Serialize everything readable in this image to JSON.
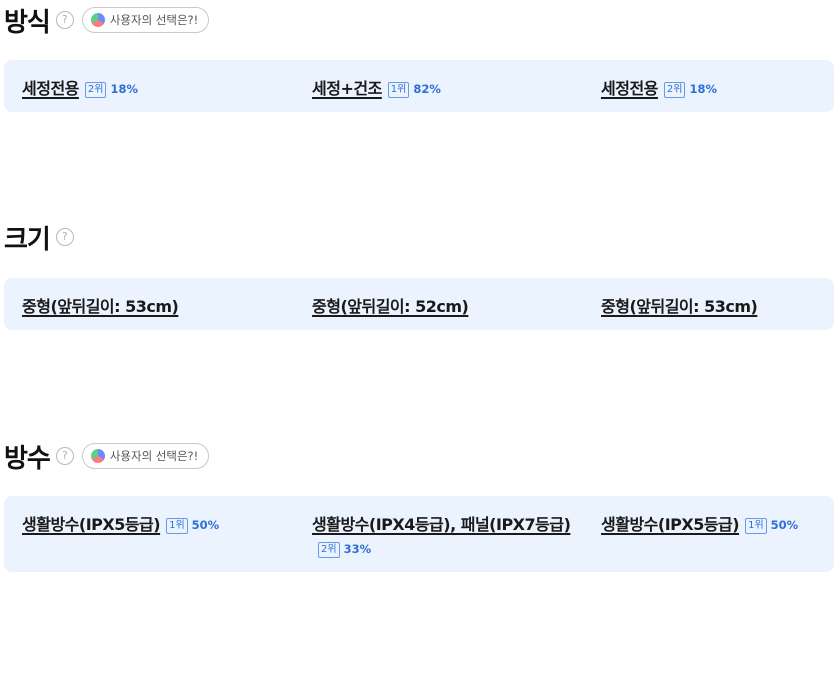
{
  "sections": [
    {
      "title": "방식",
      "chip": "사용자의 선택은?!",
      "options": [
        {
          "label": "세정전용",
          "rank": "2위",
          "percent": "18%"
        },
        {
          "label": "세정+건조",
          "rank": "1위",
          "percent": "82%"
        },
        {
          "label": "세정전용",
          "rank": "2위",
          "percent": "18%"
        }
      ]
    },
    {
      "title": "크기",
      "options": [
        {
          "label": "중형(앞뒤길이: 53cm)"
        },
        {
          "label": "중형(앞뒤길이: 52cm)"
        },
        {
          "label": "중형(앞뒤길이: 53cm)"
        }
      ]
    },
    {
      "title": "방수",
      "chip": "사용자의 선택은?!",
      "options": [
        {
          "label": "생활방수(IPX5등급)",
          "rank": "1위",
          "percent": "50%"
        },
        {
          "label": "생활방수(IPX4등급), 패널(IPX7등급)",
          "rank": "2위",
          "percent": "33%"
        },
        {
          "label": "생활방수(IPX5등급)",
          "rank": "1위",
          "percent": "50%"
        }
      ]
    }
  ],
  "icons": {
    "help": "question-mark-circle-icon",
    "chip": "pie-chart-icon"
  },
  "colors": {
    "card_background": "#ebf3ff",
    "accent": "#2f6fd6"
  }
}
